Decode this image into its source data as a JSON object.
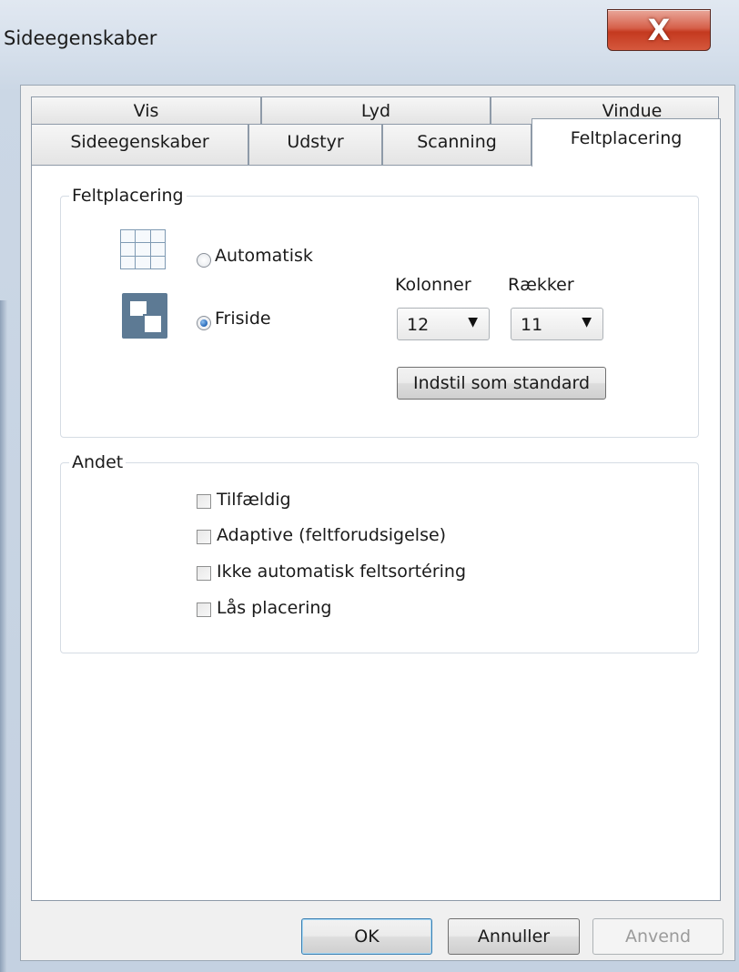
{
  "window": {
    "title": "Sideegenskaber",
    "close_glyph": "X",
    "close_color": "#c4391f"
  },
  "tabs": {
    "row_back": [
      "Vis",
      "Lyd",
      "Vindue"
    ],
    "row_front": [
      "Sideegenskaber",
      "Udstyr",
      "Scanning",
      "Feltplacering"
    ],
    "active": "Feltplacering"
  },
  "group_placement": {
    "title": "Feltplacering",
    "radio_auto_label": "Automatisk",
    "radio_free_label": "Friside",
    "selected": "Friside",
    "columns_label": "Kolonner",
    "columns_value": "12",
    "rows_label": "Rækker",
    "rows_value": "11",
    "set_default_label": "Indstil som standard",
    "icons": [
      "grid-layout-icon",
      "free-layout-icon"
    ]
  },
  "group_other": {
    "title": "Andet",
    "checkboxes": [
      {
        "label": "Tilfældig",
        "checked": false
      },
      {
        "label": "Adaptive (feltforudsigelse)",
        "checked": false
      },
      {
        "label": "Ikke automatisk feltsortéring",
        "checked": false
      },
      {
        "label": "Lås placering",
        "checked": false
      }
    ]
  },
  "buttons": {
    "ok": "OK",
    "cancel": "Annuller",
    "apply": "Anvend",
    "apply_enabled": false
  },
  "arrow_glyph": "▼"
}
